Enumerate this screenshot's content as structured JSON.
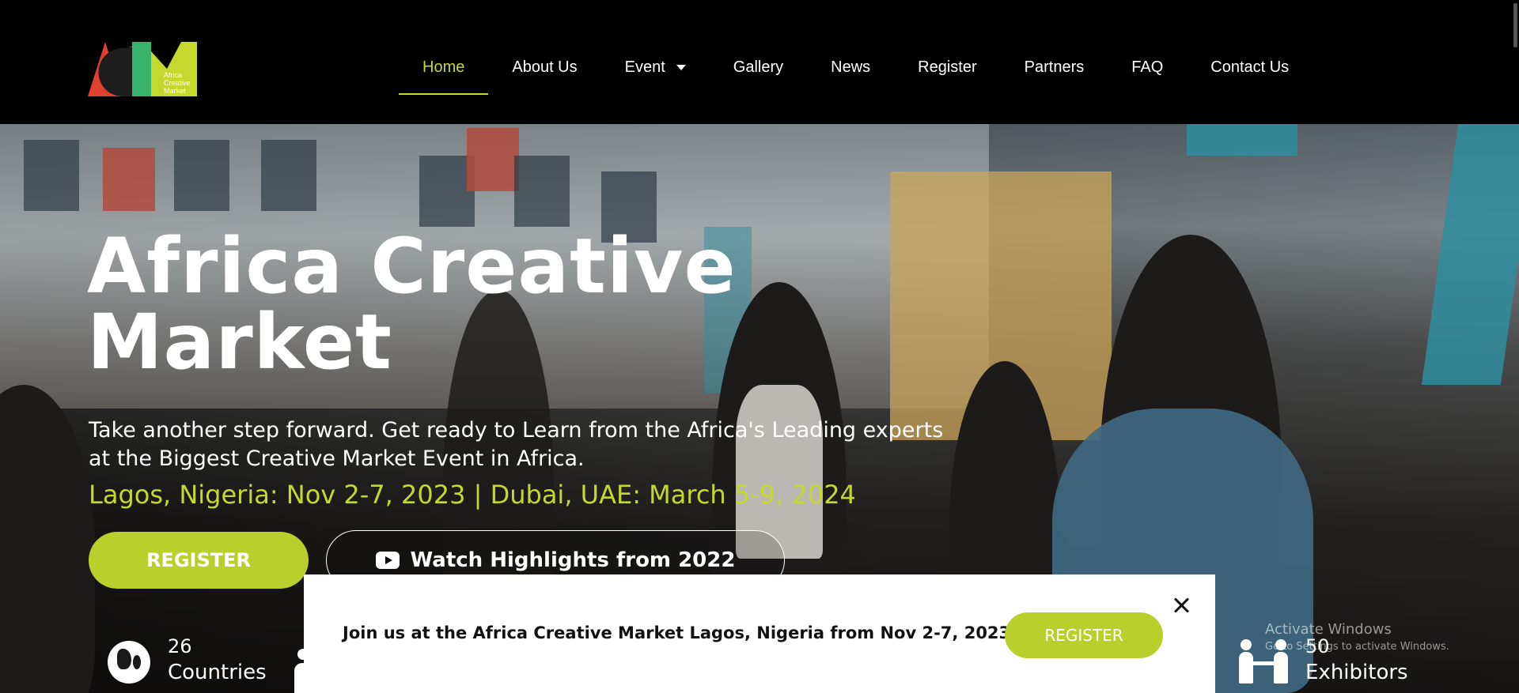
{
  "nav": {
    "items": [
      {
        "label": "Home",
        "active": true
      },
      {
        "label": "About Us"
      },
      {
        "label": "Event",
        "has_dropdown": true
      },
      {
        "label": "Gallery"
      },
      {
        "label": "News"
      },
      {
        "label": "Register"
      },
      {
        "label": "Partners"
      },
      {
        "label": "FAQ"
      },
      {
        "label": "Contact Us"
      }
    ]
  },
  "logo": {
    "text_line1": "Africa",
    "text_line2": "Creative",
    "text_line3": "Market"
  },
  "hero": {
    "title_line1": "Africa Creative",
    "title_line2": "Market",
    "subtitle_line1": "Take another step forward. Get ready to Learn from the Africa's Leading experts",
    "subtitle_line2": "at the Biggest Creative Market Event in Africa.",
    "dates": "Lagos, Nigeria: Nov 2-7, 2023 | Dubai, UAE: March 5-9, 2024",
    "register_label": "REGISTER",
    "watch_label": "Watch Highlights from 2022"
  },
  "stats": {
    "countries": {
      "number": "26",
      "label": "Countries"
    },
    "exhibitors": {
      "number": "50",
      "label": "Exhibitors"
    }
  },
  "popup": {
    "message": "Join us at the Africa Creative Market Lagos, Nigeria from Nov 2-7, 2023.",
    "register_label": "REGISTER"
  },
  "watermark": {
    "line1": "Activate Windows",
    "line2": "Go to Settings to activate Windows."
  },
  "colors": {
    "accent": "#c4d82e",
    "button": "#b9cf2c",
    "header_bg": "#000000"
  }
}
